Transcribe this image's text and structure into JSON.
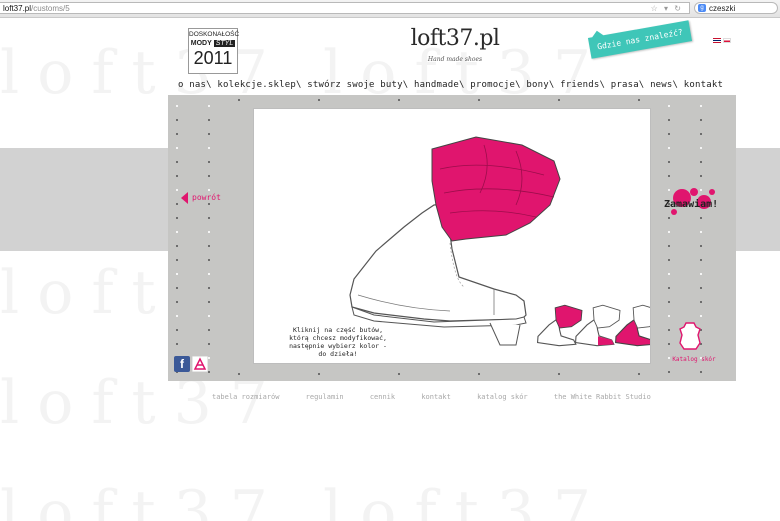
{
  "browser": {
    "url_host": "loft37.pl",
    "url_path": "/customs/5",
    "search_text": "czeszki"
  },
  "header": {
    "badge": {
      "line1": "DOSKONAŁOŚĆ",
      "line2a": "MODY",
      "line2b": "STYL",
      "year": "2011"
    },
    "logo": "loft37.pl",
    "logo_tagline": "Hand made shoes",
    "location_tag": "Gdzie nas znaleźć?"
  },
  "nav": {
    "items": [
      {
        "label": "o nas\\"
      },
      {
        "label": "kolekcje.sklep\\"
      },
      {
        "label": "stwórz swoje buty\\"
      },
      {
        "label": "handmade\\"
      },
      {
        "label": "promocje\\"
      },
      {
        "label": "bony\\"
      },
      {
        "label": "friends\\"
      },
      {
        "label": "prasa\\"
      },
      {
        "label": "news\\"
      },
      {
        "label": "kontakt"
      }
    ]
  },
  "customizer": {
    "back_label": "powrót",
    "order_label": "Zamawiam!",
    "hint_lines": [
      "Kliknij na część butów,",
      "którą chcesz modyfikować,",
      "następnie wybierz kolor -",
      "do dzieła!"
    ],
    "leather_catalog_label": "Katalog skór",
    "accent_color": "#e0156e"
  },
  "footer": {
    "links": [
      "tabela rozmiarów",
      "regulamin",
      "cennik",
      "kontakt",
      "katalog skór",
      "the White Rabbit Studio"
    ]
  }
}
